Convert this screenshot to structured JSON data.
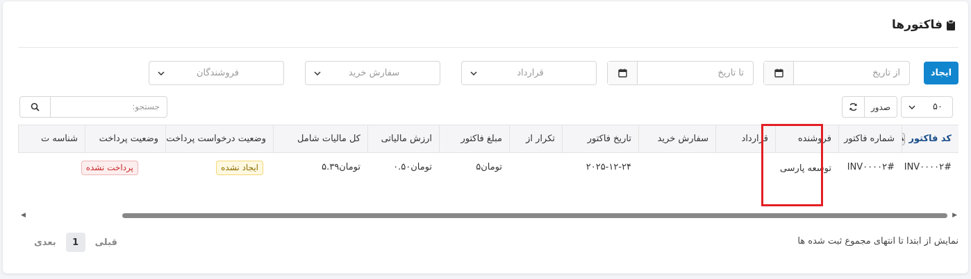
{
  "header": {
    "title": "فاکتورها"
  },
  "filters": {
    "create_label": "ایجاد",
    "from_date_placeholder": "از تاریخ",
    "to_date_placeholder": "تا تاریخ",
    "contract_placeholder": "قرارداد",
    "purchase_order_placeholder": "سفارش خرید",
    "vendors_placeholder": "فروشندگان"
  },
  "toolbar": {
    "page_size": "۵۰",
    "export_label": "صدور",
    "search_placeholder": "جستجو:"
  },
  "table": {
    "columns": [
      "کد فاکتور",
      "شماره فاکتور",
      "فروشنده",
      "قرارداد",
      "سفارش خرید",
      "تاریخ فاکتور",
      "تکرار از",
      "مبلغ فاکتور",
      "ارزش مالیاتی",
      "کل مالیات شامل",
      "وضعیت درخواست پرداخت",
      "وضعیت پرداخت",
      "شناسه ت"
    ],
    "rows": [
      {
        "invoice_code": "INV۰۰۰۰۲#",
        "invoice_number": "INV۰۰۰۰۲#",
        "vendor": "توسعه پارسی",
        "contract": "",
        "purchase_order": "",
        "invoice_date": "۲۰۲۵-۱۲-۲۴",
        "recurring_from": "",
        "invoice_amount": "تومان۵",
        "tax_value": "تومان۰.۵۰",
        "total_incl_tax": "تومان۵.۳۹",
        "payment_request_status": "ایجاد نشده",
        "payment_status": "پرداخت نشده"
      }
    ]
  },
  "footer": {
    "info": "نمایش از ابتدا تا انتهای مجموع ثبت شده ها",
    "prev_label": "قبلی",
    "current_page": "1",
    "next_label": "بعدی"
  },
  "colors": {
    "primary": "#1186cf",
    "highlight": "#e31e24",
    "unpaid": "#c62828",
    "pending": "#8a6d00"
  }
}
